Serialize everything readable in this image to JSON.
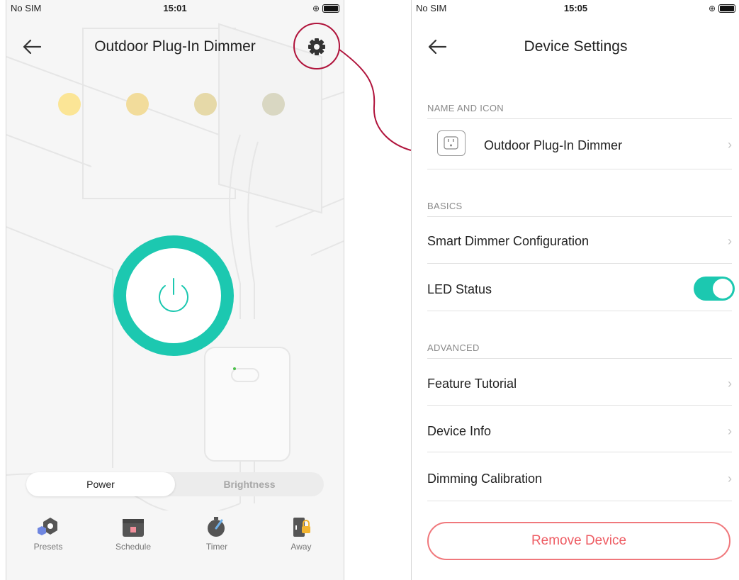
{
  "left_screen": {
    "status": {
      "carrier": "No SIM",
      "time": "15:01"
    },
    "title": "Outdoor Plug-In Dimmer",
    "dot_colors": [
      "#fbe596",
      "#f2dc9b",
      "#e6d9a8",
      "#d9d7c2"
    ],
    "accent": "#1cc8b0",
    "segment": {
      "power": "Power",
      "brightness": "Brightness"
    },
    "toolbar": [
      {
        "label": "Presets",
        "icon": "presets-icon"
      },
      {
        "label": "Schedule",
        "icon": "calendar-icon"
      },
      {
        "label": "Timer",
        "icon": "stopwatch-icon"
      },
      {
        "label": "Away",
        "icon": "away-lock-icon"
      }
    ]
  },
  "right_screen": {
    "status": {
      "carrier": "No SIM",
      "time": "15:05"
    },
    "title": "Device Settings",
    "sections": {
      "name_icon": "NAME AND ICON",
      "basics": "BASICS",
      "advanced": "ADVANCED"
    },
    "device_name": "Outdoor Plug-In Dimmer",
    "rows": {
      "smart_dimmer": "Smart Dimmer Configuration",
      "led_status": "LED Status",
      "feature_tutorial": "Feature Tutorial",
      "device_info": "Device Info",
      "dimming_calibration": "Dimming Calibration"
    },
    "led_status_on": true,
    "remove_label": "Remove Device",
    "remove_color": "#ee5c63"
  },
  "annotation_color": "#b0143c"
}
